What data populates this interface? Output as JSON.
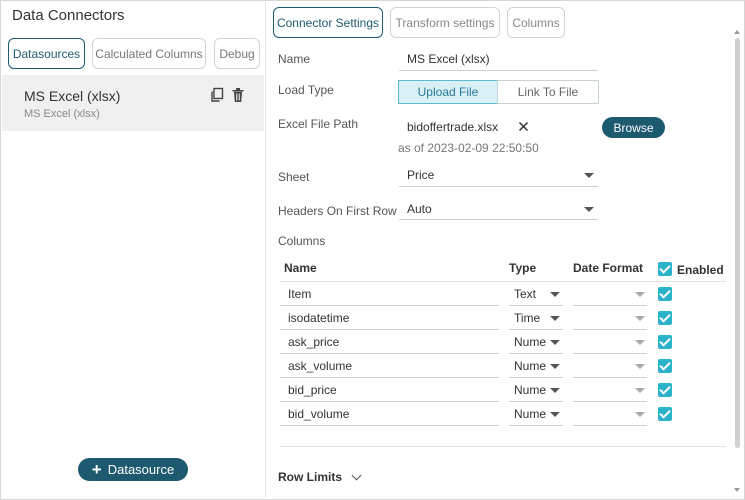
{
  "left": {
    "title": "Data Connectors",
    "tabs": [
      {
        "label": "Datasources"
      },
      {
        "label": "Calculated Columns"
      },
      {
        "label": "Debug"
      }
    ],
    "datasource": {
      "name": "MS Excel (xlsx)",
      "subtitle": "MS Excel (xlsx)"
    },
    "add_button": "Datasource"
  },
  "tabs": [
    {
      "label": "Connector Settings"
    },
    {
      "label": "Transform settings"
    },
    {
      "label": "Columns"
    }
  ],
  "form": {
    "name_label": "Name",
    "name_value": "MS Excel (xlsx)",
    "load_type_label": "Load Type",
    "load_type_options": [
      "Upload File",
      "Link To File"
    ],
    "file_path_label": "Excel File Path",
    "file_name": "bidoffertrade.xlsx",
    "file_date": "as of 2023-02-09 22:50:50",
    "browse_label": "Browse",
    "sheet_label": "Sheet",
    "sheet_value": "Price",
    "headers_label": "Headers On First Row",
    "headers_value": "Auto",
    "columns_label": "Columns"
  },
  "columns_table": {
    "headers": {
      "name": "Name",
      "type": "Type",
      "date_format": "Date Format",
      "enabled": "Enabled"
    },
    "rows": [
      {
        "name": "Item",
        "type": "Text",
        "enabled": true
      },
      {
        "name": "isodatetime",
        "type": "Time",
        "enabled": true
      },
      {
        "name": "ask_price",
        "type": "Nume",
        "enabled": true
      },
      {
        "name": "ask_volume",
        "type": "Nume",
        "enabled": true
      },
      {
        "name": "bid_price",
        "type": "Nume",
        "enabled": true
      },
      {
        "name": "bid_volume",
        "type": "Nume",
        "enabled": true
      }
    ]
  },
  "row_limits_label": "Row Limits",
  "colors": {
    "accent": "#1d5a70",
    "checkbox": "#2ab3c9",
    "segment_active_bg": "#d9f0f6"
  }
}
